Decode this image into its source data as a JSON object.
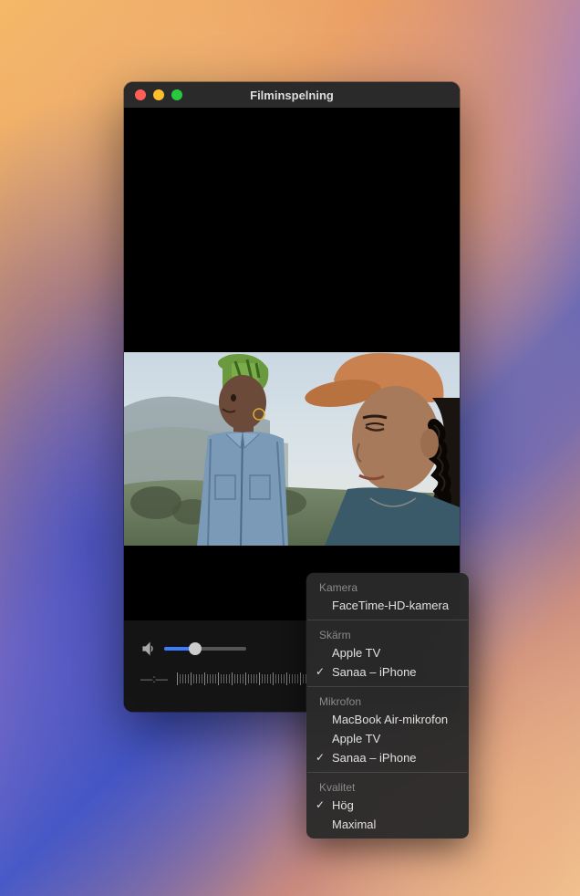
{
  "window": {
    "title": "Filminspelning"
  },
  "controls": {
    "time": "––:––",
    "volume_percent": 38
  },
  "menu": {
    "sections": [
      {
        "header": "Kamera",
        "items": [
          {
            "label": "FaceTime-HD-kamera",
            "checked": false
          }
        ]
      },
      {
        "header": "Skärm",
        "items": [
          {
            "label": "Apple TV",
            "checked": false
          },
          {
            "label": "Sanaa – iPhone",
            "checked": true
          }
        ]
      },
      {
        "header": "Mikrofon",
        "items": [
          {
            "label": "MacBook Air-mikrofon",
            "checked": false
          },
          {
            "label": "Apple TV",
            "checked": false
          },
          {
            "label": "Sanaa – iPhone",
            "checked": true
          }
        ]
      },
      {
        "header": "Kvalitet",
        "items": [
          {
            "label": "Hög",
            "checked": true
          },
          {
            "label": "Maximal",
            "checked": false
          }
        ]
      }
    ]
  }
}
